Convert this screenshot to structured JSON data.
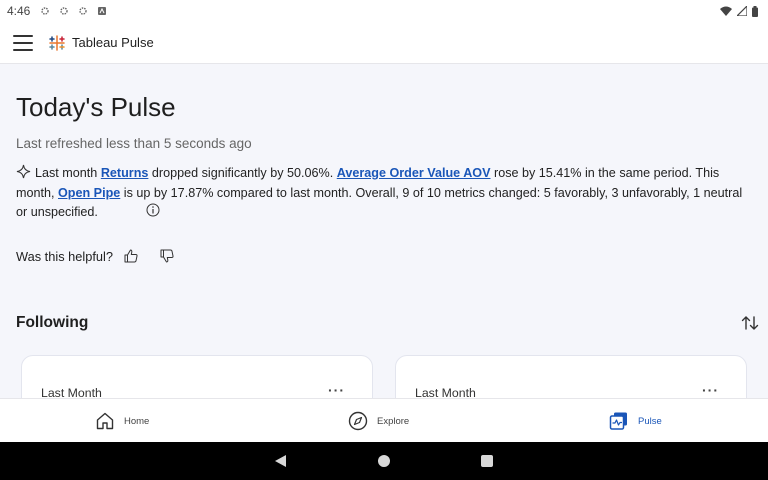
{
  "status_bar": {
    "time": "4:46"
  },
  "app_bar": {
    "title": "Tableau Pulse"
  },
  "main": {
    "page_title": "Today's Pulse",
    "refreshed": "Last refreshed less than 5 seconds ago",
    "insight": {
      "t1": "Last month ",
      "link1": "Returns",
      "t2": " dropped significantly by 50.06%. ",
      "link2": "Average Order Value AOV",
      "t3": " rose by 15.41% in the same period. This month, ",
      "link3": "Open Pipe",
      "t4": " is up by 17.87% compared to last month. Overall, 9 of 10 metrics changed: 5 favorably, 3 unfavorably, 1 neutral or unspecified."
    },
    "helpful_label": "Was this helpful?",
    "following_label": "Following",
    "cards": [
      {
        "period": "Last Month",
        "more": "···"
      },
      {
        "period": "Last Month",
        "more": "···"
      }
    ]
  },
  "bottom_nav": {
    "items": [
      {
        "label": "Home",
        "icon": "home-icon"
      },
      {
        "label": "Explore",
        "icon": "compass-icon"
      },
      {
        "label": "Pulse",
        "icon": "pulse-icon",
        "active": true
      }
    ]
  },
  "colors": {
    "accent": "#1a56b8",
    "background": "#f5f6fb"
  }
}
